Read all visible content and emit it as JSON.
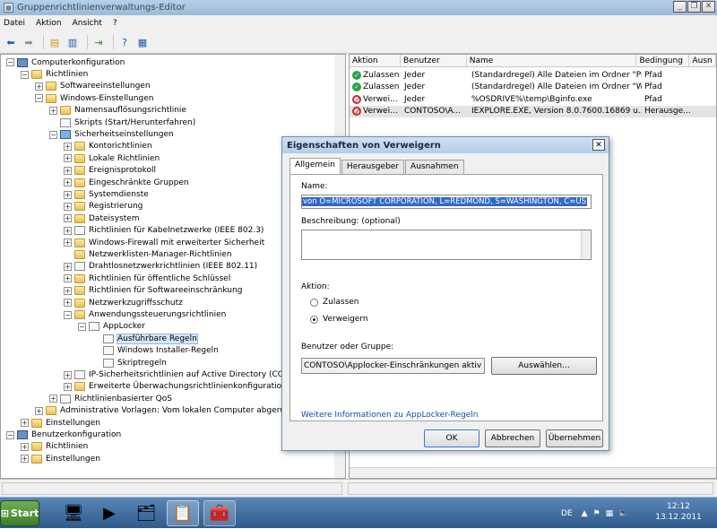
{
  "window": {
    "title": "Gruppenrichtlinienverwaltungs-Editor",
    "min": "_",
    "max": "❐",
    "close": "✕"
  },
  "menu": [
    "Datei",
    "Aktion",
    "Ansicht",
    "?"
  ],
  "toolbar_icons": [
    "back-arrow-icon",
    "forward-arrow-icon",
    "up-folder-icon",
    "show-hide-tree-icon",
    "export-icon",
    "help-icon",
    "properties-icon"
  ],
  "tree": [
    {
      "label": "Computerkonfiguration",
      "level": 0,
      "exp": "−",
      "icon": "comp"
    },
    {
      "label": "Richtlinien",
      "level": 1,
      "exp": "−",
      "icon": "folder"
    },
    {
      "label": "Softwareeinstellungen",
      "level": 2,
      "exp": "+",
      "icon": "folder"
    },
    {
      "label": "Windows-Einstellungen",
      "level": 2,
      "exp": "−",
      "icon": "folder"
    },
    {
      "label": "Namensauflösungsrichtlinie",
      "level": 3,
      "exp": "+",
      "icon": "folder"
    },
    {
      "label": "Skripts (Start/Herunterfahren)",
      "level": 3,
      "exp": "",
      "icon": "doc"
    },
    {
      "label": "Sicherheitseinstellungen",
      "level": 3,
      "exp": "−",
      "icon": "shield"
    },
    {
      "label": "Kontorichtlinien",
      "level": 4,
      "exp": "+",
      "icon": "folder"
    },
    {
      "label": "Lokale Richtlinien",
      "level": 4,
      "exp": "+",
      "icon": "folder"
    },
    {
      "label": "Ereignisprotokoll",
      "level": 4,
      "exp": "+",
      "icon": "folder"
    },
    {
      "label": "Eingeschränkte Gruppen",
      "level": 4,
      "exp": "+",
      "icon": "folder"
    },
    {
      "label": "Systemdienste",
      "level": 4,
      "exp": "+",
      "icon": "folder"
    },
    {
      "label": "Registrierung",
      "level": 4,
      "exp": "+",
      "icon": "folder"
    },
    {
      "label": "Dateisystem",
      "level": 4,
      "exp": "+",
      "icon": "folder"
    },
    {
      "label": "Richtlinien für Kabelnetzwerke (IEEE 802.3)",
      "level": 4,
      "exp": "+",
      "icon": "doc"
    },
    {
      "label": "Windows-Firewall mit erweiterter Sicherheit",
      "level": 4,
      "exp": "+",
      "icon": "folder"
    },
    {
      "label": "Netzwerklisten-Manager-Richtlinien",
      "level": 4,
      "exp": "",
      "icon": "folder"
    },
    {
      "label": "Drahtlosnetzwerkrichtlinien (IEEE 802.11)",
      "level": 4,
      "exp": "+",
      "icon": "doc"
    },
    {
      "label": "Richtlinien für öffentliche Schlüssel",
      "level": 4,
      "exp": "+",
      "icon": "folder"
    },
    {
      "label": "Richtlinien für Softwareeinschränkung",
      "level": 4,
      "exp": "+",
      "icon": "folder"
    },
    {
      "label": "Netzwerkzugriffsschutz",
      "level": 4,
      "exp": "+",
      "icon": "folder"
    },
    {
      "label": "Anwendungssteuerungsrichtlinien",
      "level": 4,
      "exp": "−",
      "icon": "folder"
    },
    {
      "label": "AppLocker",
      "level": 5,
      "exp": "−",
      "icon": "doc"
    },
    {
      "label": "Ausführbare Regeln",
      "level": 6,
      "exp": "",
      "icon": "doc",
      "selected": true
    },
    {
      "label": "Windows Installer-Regeln",
      "level": 6,
      "exp": "",
      "icon": "doc"
    },
    {
      "label": "Skriptregeln",
      "level": 6,
      "exp": "",
      "icon": "doc"
    },
    {
      "label": "IP-Sicherheitsrichtlinien auf Active Directory (CONTOSO.COM)",
      "level": 4,
      "exp": "+",
      "icon": "doc"
    },
    {
      "label": "Erweiterte Überwachungsrichtlinienkonfiguration",
      "level": 4,
      "exp": "+",
      "icon": "folder"
    },
    {
      "label": "Richtlinienbasierter QoS",
      "level": 3,
      "exp": "+",
      "icon": "doc"
    },
    {
      "label": "Administrative Vorlagen: Vom lokalen Computer abgerufene Richtliniendefinitionen",
      "level": 2,
      "exp": "+",
      "icon": "folder"
    },
    {
      "label": "Einstellungen",
      "level": 1,
      "exp": "+",
      "icon": "folder"
    },
    {
      "label": "Benutzerkonfiguration",
      "level": 0,
      "exp": "−",
      "icon": "comp"
    },
    {
      "label": "Richtlinien",
      "level": 1,
      "exp": "+",
      "icon": "folder"
    },
    {
      "label": "Einstellungen",
      "level": 1,
      "exp": "+",
      "icon": "folder"
    }
  ],
  "rules_table": {
    "columns": [
      "Aktion",
      "Benutzer",
      "Name",
      "Bedingung",
      "Ausn"
    ],
    "rows": [
      {
        "action": "Zulassen",
        "type": "allow",
        "user": "Jeder",
        "name": "(Standardregel) Alle Dateien im Ordner \"Pr...",
        "condition": "Pfad"
      },
      {
        "action": "Zulassen",
        "type": "allow",
        "user": "Jeder",
        "name": "(Standardregel) Alle Dateien im Ordner \"Wi...",
        "condition": "Pfad"
      },
      {
        "action": "Verwei...",
        "type": "deny",
        "user": "Jeder",
        "name": "%OSDRIVE%\\temp\\Bginfo.exe",
        "condition": "Pfad"
      },
      {
        "action": "Verwei...",
        "type": "deny",
        "user": "CONTOSO\\A...",
        "name": "IEXPLORE.EXE, Version 8.0.7600.16869 u...",
        "condition": "Herausge..."
      }
    ]
  },
  "dialog": {
    "title": "Eigenschaften von Verweigern",
    "close": "✕",
    "tabs": [
      "Allgemein",
      "Herausgeber",
      "Ausnahmen"
    ],
    "name_label": "Name:",
    "name_value": "von O=MICROSOFT CORPORATION, L=REDMOND, S=WASHINGTON, C=US",
    "desc_label": "Beschreibung: (optional)",
    "action_label": "Aktion:",
    "allow_label": "Zulassen",
    "deny_label": "Verweigern",
    "user_label": "Benutzer oder Gruppe:",
    "user_value": "CONTOSO\\Applocker-Einschränkungen aktiv",
    "select_btn": "Auswählen...",
    "link": "Weitere Informationen zu AppLocker-Regeln",
    "ok": "OK",
    "cancel": "Abbrechen",
    "apply": "Übernehmen"
  },
  "taskbar": {
    "start": "Start",
    "lang": "DE",
    "time": "12:12",
    "date": "13.12.2011"
  }
}
